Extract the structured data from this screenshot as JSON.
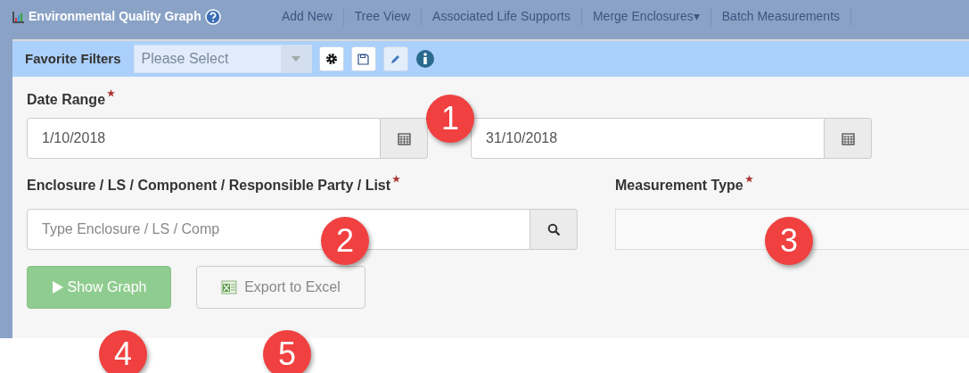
{
  "background_toolbar": {
    "items": [
      {
        "label": "Add New"
      },
      {
        "label": "Tree View"
      },
      {
        "label": "Associated Life Supports"
      },
      {
        "label": "Merge Enclosures▾"
      },
      {
        "label": "Batch Measurements"
      }
    ]
  },
  "dialog": {
    "title": "Environmental Quality Graph"
  },
  "favorite_filters": {
    "label": "Favorite Filters",
    "placeholder": "Please Select"
  },
  "date_range": {
    "label": "Date Range",
    "required": true,
    "from": "1/10/2018",
    "to": "31/10/2018"
  },
  "enclosure": {
    "label": "Enclosure / LS / Component / Responsible Party / List",
    "required": true,
    "placeholder": "Type Enclosure / LS / Comp"
  },
  "measurement_type": {
    "label": "Measurement Type",
    "required": true
  },
  "buttons": [
    {
      "kind": "play",
      "label": "Show Graph",
      "disabled": true
    },
    {
      "kind": "excel",
      "label": "Export to Excel",
      "disabled": true
    }
  ],
  "callouts": [
    {
      "label": "1"
    },
    {
      "label": "2"
    },
    {
      "label": "3"
    },
    {
      "label": "4"
    },
    {
      "label": "5"
    }
  ]
}
